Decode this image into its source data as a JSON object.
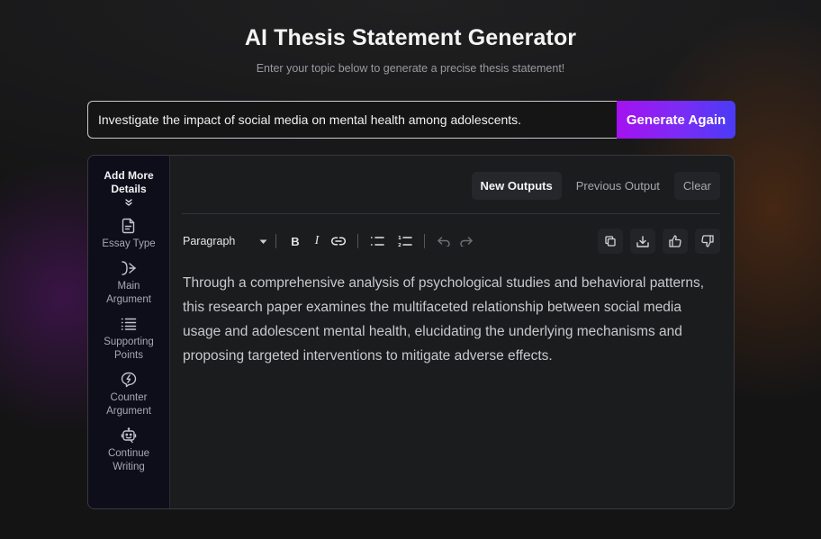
{
  "header": {
    "title": "AI Thesis Statement Generator",
    "subtitle": "Enter your topic below to generate a precise thesis statement!"
  },
  "topic_input": {
    "value": "Investigate the impact of social media on mental health among adolescents.",
    "placeholder": ""
  },
  "generate_button": {
    "label": "Generate Again",
    "gradient": [
      "#a412f0",
      "#4a3bf6"
    ]
  },
  "sidebar": {
    "heading": "Add More Details",
    "expand_icon": "chevrons-down-icon",
    "items": [
      {
        "label": "Essay Type",
        "icon": "document-icon"
      },
      {
        "label": "Main\nArgument",
        "icon": "branch-arrow-icon"
      },
      {
        "label": "Supporting\nPoints",
        "icon": "list-icon"
      },
      {
        "label": "Counter\nArgument",
        "icon": "lightning-bubble-icon"
      },
      {
        "label": "Continue\nWriting",
        "icon": "robot-icon"
      }
    ]
  },
  "output_tabs": [
    {
      "label": "New Outputs",
      "active": true
    },
    {
      "label": "Previous Output",
      "active": false
    },
    {
      "label": "Clear",
      "active": false
    }
  ],
  "toolbar": {
    "block_format": "Paragraph",
    "bold": "B",
    "italic": "I",
    "buttons": [
      "bold-icon",
      "italic-icon",
      "link-icon",
      "bullet-list-icon",
      "numbered-list-icon",
      "undo-icon",
      "redo-icon"
    ],
    "actions": [
      "copy-icon",
      "download-icon",
      "thumbs-up-icon",
      "thumbs-down-icon"
    ]
  },
  "output": {
    "text": "Through a comprehensive analysis of psychological studies and behavioral patterns, this research paper examines the multifaceted relationship between social media usage and adolescent mental health, elucidating the underlying mechanisms and proposing targeted interventions to mitigate adverse effects."
  },
  "colors": {
    "background": "#141415",
    "card": "#1b1c1e",
    "sidebar": "#0e0d1a",
    "accent_purple": "#a412f0",
    "accent_blue": "#4a3bf6"
  }
}
